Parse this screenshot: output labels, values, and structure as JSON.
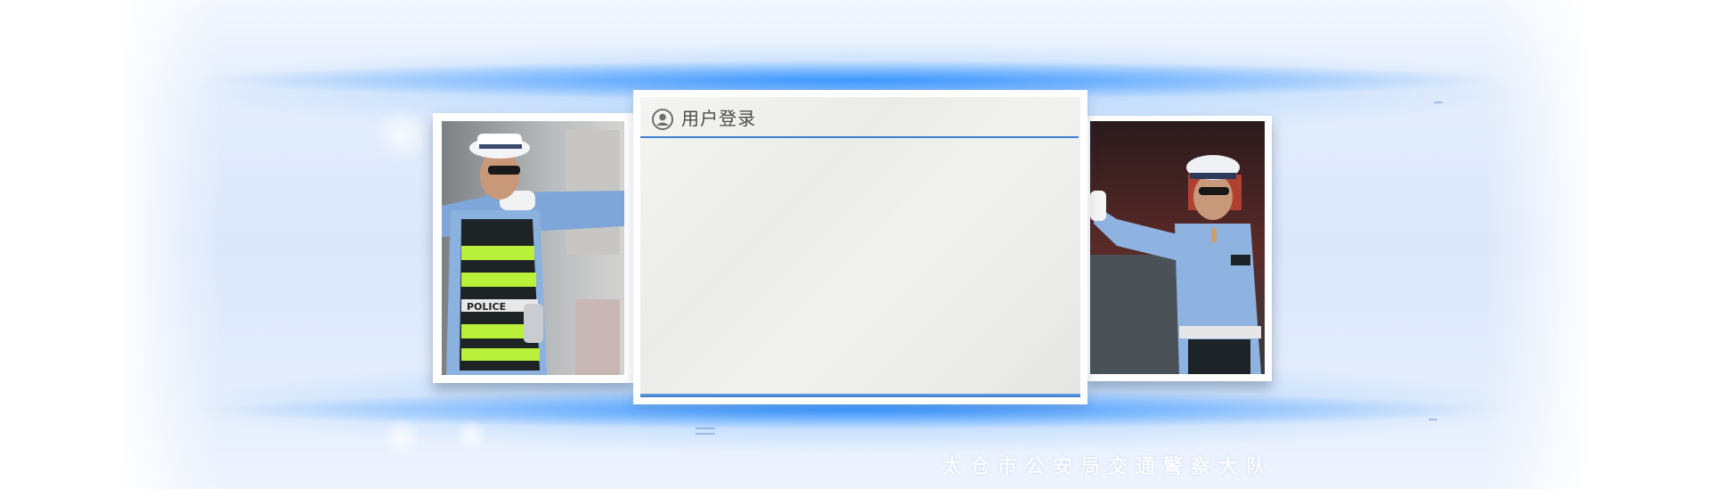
{
  "login": {
    "title": "用户登录",
    "icon": "user-circle-icon",
    "accent_color": "#3f7fd1"
  },
  "footer": {
    "org_name": "太仓市公安局交通警察大队"
  },
  "photos": {
    "left": "traffic-police-officer-photo",
    "right": "traffic-police-officer-photo"
  },
  "theme": {
    "glow_color": "#288cff",
    "background": "#e3edfc"
  }
}
